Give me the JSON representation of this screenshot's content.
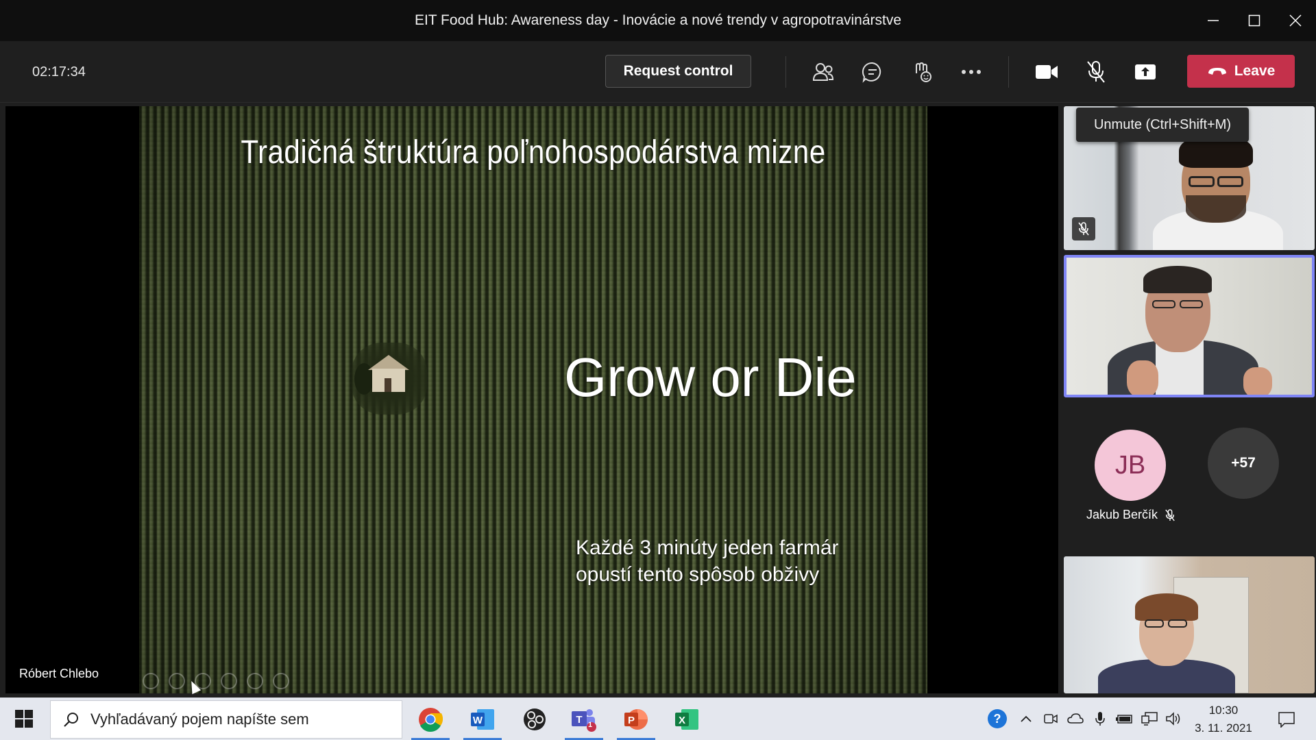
{
  "window": {
    "title": "EIT Food Hub: Awareness day - Inovácie a nové trendy v agropotravinárstve"
  },
  "toolbar": {
    "timer": "02:17:34",
    "request_control_label": "Request control",
    "leave_label": "Leave",
    "icons": [
      "people-icon",
      "chat-icon",
      "reactions-icon",
      "more-icon",
      "camera-icon",
      "mic-off-icon",
      "share-icon"
    ],
    "leave_color": "#c4314b"
  },
  "tooltip": {
    "text": "Unmute (Ctrl+Shift+M)"
  },
  "slide": {
    "title": "Tradičná štruktúra poľnohospodárstva mizne",
    "headline": "Grow or Die",
    "subtitle_line1": "Každé 3 minúty jeden farmár",
    "subtitle_line2": "opustí tento spôsob obživy"
  },
  "stage": {
    "presenter_name": "Róbert Chlebo"
  },
  "participants": {
    "avatar_initials": "JB",
    "avatar_name": "Jakub Berčík",
    "more_count": "+57",
    "active_speaker_border": "#7f85f5"
  },
  "taskbar": {
    "search_placeholder": "Vyhľadávaný pojem napíšte sem",
    "apps": [
      "chrome-icon",
      "word-icon",
      "obs-icon",
      "teams-icon",
      "powerpoint-icon",
      "excel-icon"
    ],
    "teams_badge": "1",
    "clock_time": "10:30",
    "clock_date": "3. 11. 2021"
  }
}
